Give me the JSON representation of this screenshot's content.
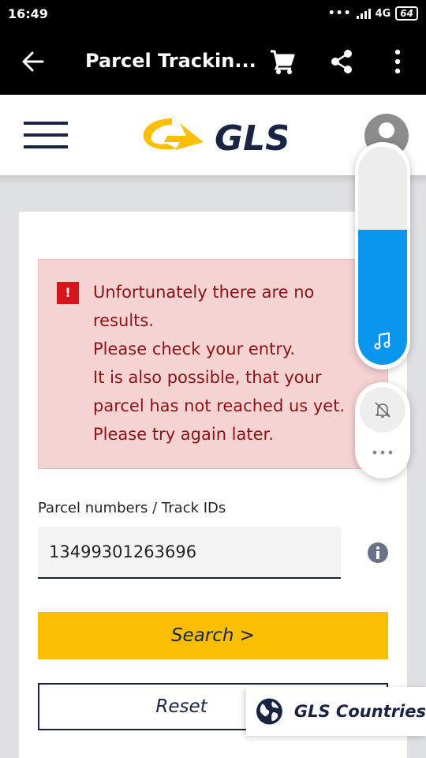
{
  "status_bar": {
    "time": "16:49",
    "network": "4G",
    "battery": "64"
  },
  "app_bar": {
    "title": "Parcel Trackin...",
    "icons": [
      "back-arrow-icon",
      "cart-icon",
      "share-icon",
      "more-vert-icon"
    ]
  },
  "gls_header": {
    "logo_text": "GLS",
    "icons": [
      "hamburger-icon",
      "avatar-icon"
    ]
  },
  "alert": {
    "lines": [
      "Unfortunately there are no",
      "results.",
      "Please check your entry.",
      "It is also possible, that your",
      "parcel has not reached us yet.",
      "Please try again later."
    ],
    "color": "#8b1212",
    "background": "#f6d3d3"
  },
  "form": {
    "label": "Parcel numbers / Track IDs",
    "value": "13499301263696",
    "search_label": "Search >",
    "reset_label": "Reset",
    "accent": "#fbbe00",
    "brand_navy": "#1a2442"
  },
  "countries": {
    "label": "GLS Countries"
  },
  "volume_overlay": {
    "level": 0.62,
    "fill_color": "#0a96ef"
  }
}
